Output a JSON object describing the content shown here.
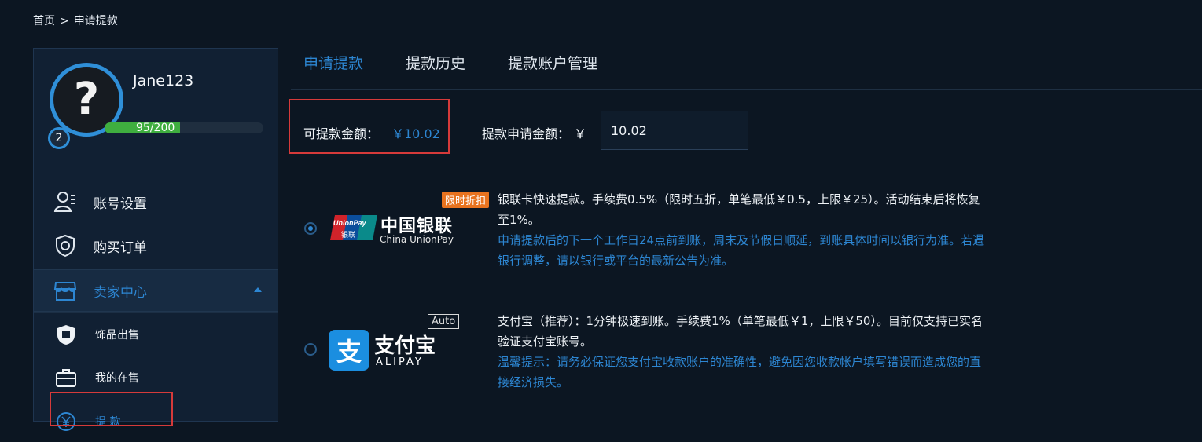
{
  "breadcrumb": {
    "home": "首页",
    "sep": ">",
    "current": "申请提款"
  },
  "user": {
    "name": "Jane123",
    "level": "2",
    "xp_current": "95",
    "xp_total": "/200",
    "xp_fraction": 0.475,
    "avatar_glyph": "?"
  },
  "sidebar": {
    "items": [
      {
        "label": "账号设置",
        "icon": "user-settings-icon"
      },
      {
        "label": "购买订单",
        "icon": "shield-order-icon"
      },
      {
        "label": "卖家中心",
        "icon": "store-icon"
      }
    ],
    "sub_items": [
      {
        "label": "饰品出售",
        "icon": "sell-tag-icon"
      },
      {
        "label": "我的在售",
        "icon": "briefcase-icon"
      },
      {
        "label": "提  款",
        "icon": "yen-icon"
      }
    ]
  },
  "tabs": [
    {
      "label": "申请提款",
      "active": true
    },
    {
      "label": "提款历史",
      "active": false
    },
    {
      "label": "提款账户管理",
      "active": false
    }
  ],
  "withdraw": {
    "available_label": "可提款金额：",
    "available_value": "￥10.02",
    "request_label": "提款申请金额：",
    "currency": "￥",
    "request_value": "10.02"
  },
  "unionpay": {
    "promo": "限时折扣",
    "logo_cn": "中国银联",
    "logo_en": "China UnionPay",
    "logo_badge_top": "UnionPay",
    "logo_badge_bottom": "银联",
    "desc": "银联卡快速提款。手续费0.5%（限时五折，单笔最低￥0.5，上限￥25）。活动结束后将恢复至1%。",
    "note": "申请提款后的下一个工作日24点前到账，周末及节假日顺延，到账具体时间以银行为准。若遇银行调整，请以银行或平台的最新公告为准。"
  },
  "alipay": {
    "badge": "Auto",
    "logo_cn": "支付宝",
    "logo_en": "ALIPAY",
    "logo_glyph": "支",
    "desc": "支付宝（推荐）：1分钟极速到账。手续费1%（单笔最低￥1，上限￥50）。目前仅支持已实名验证支付宝账号。",
    "note": "温馨提示：请务必保证您支付宝收款账户的准确性，避免因您收款帐户填写错误而造成您的直接经济损失。"
  },
  "colors": {
    "accent": "#2d86d2",
    "highlight_box": "#d63a3a",
    "promo": "#e8731f",
    "xp": "#3fae3f"
  }
}
